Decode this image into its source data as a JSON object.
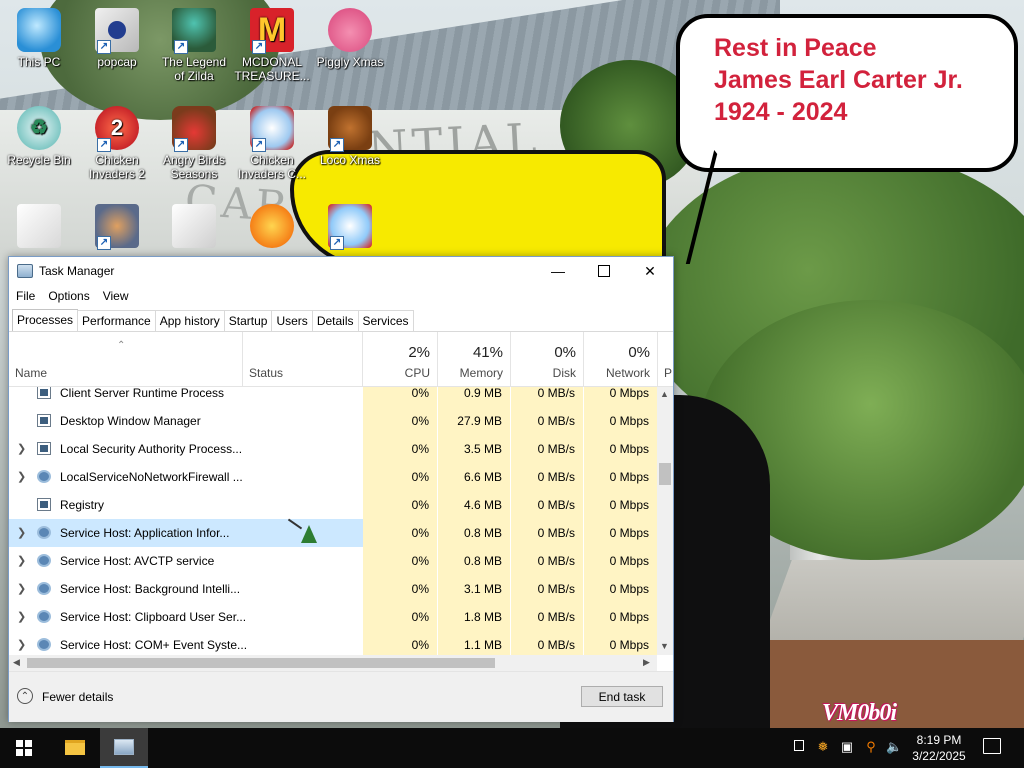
{
  "desktop": {
    "icons": [
      {
        "label": "This PC"
      },
      {
        "label": "popcap"
      },
      {
        "label": "The Legend of Zilda"
      },
      {
        "label": "MCDONAL TREASURE..."
      },
      {
        "label": "Piggly Xmas"
      },
      {
        "label": "Recycle Bin"
      },
      {
        "label": "Chicken Invaders 2"
      },
      {
        "label": "Angry Birds Seasons"
      },
      {
        "label": "Chicken Invaders C..."
      },
      {
        "label": "Loco Xmas"
      }
    ]
  },
  "wallpaper": {
    "bubble_lines": [
      "Rest in Peace",
      "James Earl Carter Jr.",
      "1924 - 2024"
    ],
    "building_text_1": "ENTIAL",
    "building_text_2": "CART",
    "watermark": "VM0b0i"
  },
  "task_manager": {
    "title": "Task Manager",
    "menu": [
      "File",
      "Options",
      "View"
    ],
    "tabs": [
      "Processes",
      "Performance",
      "App history",
      "Startup",
      "Users",
      "Details",
      "Services"
    ],
    "active_tab": "Processes",
    "columns": {
      "name": "Name",
      "status": "Status",
      "cpu": {
        "pct": "2%",
        "label": "CPU"
      },
      "memory": {
        "pct": "41%",
        "label": "Memory"
      },
      "disk": {
        "pct": "0%",
        "label": "Disk"
      },
      "network": {
        "pct": "0%",
        "label": "Network"
      },
      "power": "P"
    },
    "rows": [
      {
        "name": "Client Server Runtime Process",
        "cpu": "0%",
        "memory": "0.9 MB",
        "disk": "0 MB/s",
        "network": "0 Mbps"
      },
      {
        "name": "Desktop Window Manager",
        "cpu": "0%",
        "memory": "27.9 MB",
        "disk": "0 MB/s",
        "network": "0 Mbps"
      },
      {
        "name": "Local Security Authority Process...",
        "cpu": "0%",
        "memory": "3.5 MB",
        "disk": "0 MB/s",
        "network": "0 Mbps"
      },
      {
        "name": "LocalServiceNoNetworkFirewall ...",
        "cpu": "0%",
        "memory": "6.6 MB",
        "disk": "0 MB/s",
        "network": "0 Mbps"
      },
      {
        "name": "Registry",
        "cpu": "0%",
        "memory": "4.6 MB",
        "disk": "0 MB/s",
        "network": "0 Mbps"
      },
      {
        "name": "Service Host: Application Infor...",
        "cpu": "0%",
        "memory": "0.8 MB",
        "disk": "0 MB/s",
        "network": "0 Mbps"
      },
      {
        "name": "Service Host: AVCTP service",
        "cpu": "0%",
        "memory": "0.8 MB",
        "disk": "0 MB/s",
        "network": "0 Mbps"
      },
      {
        "name": "Service Host: Background Intelli...",
        "cpu": "0%",
        "memory": "3.1 MB",
        "disk": "0 MB/s",
        "network": "0 Mbps"
      },
      {
        "name": "Service Host: Clipboard User Ser...",
        "cpu": "0%",
        "memory": "1.8 MB",
        "disk": "0 MB/s",
        "network": "0 Mbps"
      },
      {
        "name": "Service Host: COM+ Event Syste...",
        "cpu": "0%",
        "memory": "1.1 MB",
        "disk": "0 MB/s",
        "network": "0 Mbps"
      }
    ],
    "fewer_details": "Fewer details",
    "end_task": "End task"
  },
  "taskbar": {
    "clock_time": "8:19 PM",
    "clock_date": "3/22/2025"
  }
}
